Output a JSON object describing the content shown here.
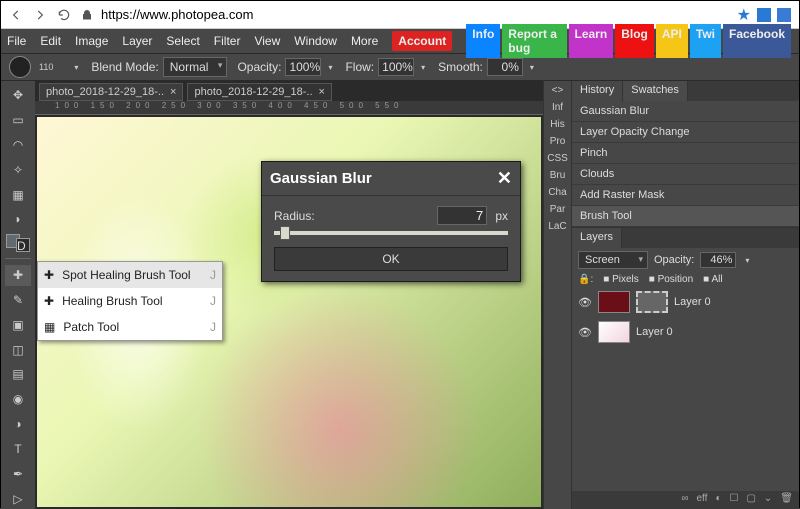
{
  "browser": {
    "url": "https://www.photopea.com",
    "star": "★"
  },
  "menu": {
    "items": [
      "File",
      "Edit",
      "Image",
      "Layer",
      "Select",
      "Filter",
      "View",
      "Window",
      "More"
    ],
    "account": "Account",
    "pills": {
      "info": "Info",
      "bug": "Report a bug",
      "learn": "Learn",
      "blog": "Blog",
      "api": "API",
      "twi": "Twi",
      "fb": "Facebook"
    }
  },
  "options": {
    "brush_size": "110",
    "blend_label": "Blend Mode:",
    "blend_value": "Normal",
    "opacity_label": "Opacity:",
    "opacity_value": "100%",
    "flow_label": "Flow:",
    "flow_value": "100%",
    "smooth_label": "Smooth:",
    "smooth_value": "0%"
  },
  "tabs": [
    "photo_2018-12-29_18-..",
    "photo_2018-12-29_18-.."
  ],
  "flyout": {
    "items": [
      {
        "label": "Spot Healing Brush Tool",
        "key": "J"
      },
      {
        "label": "Healing Brush Tool",
        "key": "J"
      },
      {
        "label": "Patch Tool",
        "key": "J"
      }
    ]
  },
  "dialog": {
    "title": "Gaussian Blur",
    "radius_label": "Radius:",
    "radius_value": "7",
    "radius_unit": "px",
    "ok": "OK"
  },
  "right_tabs": [
    "<>",
    "Inf",
    "His",
    "Pro",
    "CSS",
    "Bru",
    "Cha",
    "Par",
    "LaC"
  ],
  "history": {
    "tab1": "History",
    "tab2": "Swatches",
    "steps": [
      "Gaussian Blur",
      "Layer Opacity Change",
      "Pinch",
      "Clouds",
      "Add Raster Mask",
      "Brush Tool"
    ]
  },
  "layers": {
    "title": "Layers",
    "blend": "Screen",
    "opacity_label": "Opacity:",
    "opacity_value": "46%",
    "lock_pixels": "Pixels",
    "lock_position": "Position",
    "lock_all": "All",
    "rows": [
      {
        "name": "Layer 0"
      },
      {
        "name": "Layer 0"
      }
    ]
  },
  "bottom_icons": [
    "∞",
    "eff",
    "◐",
    "☐",
    "▢",
    "⌄",
    "🗑"
  ]
}
